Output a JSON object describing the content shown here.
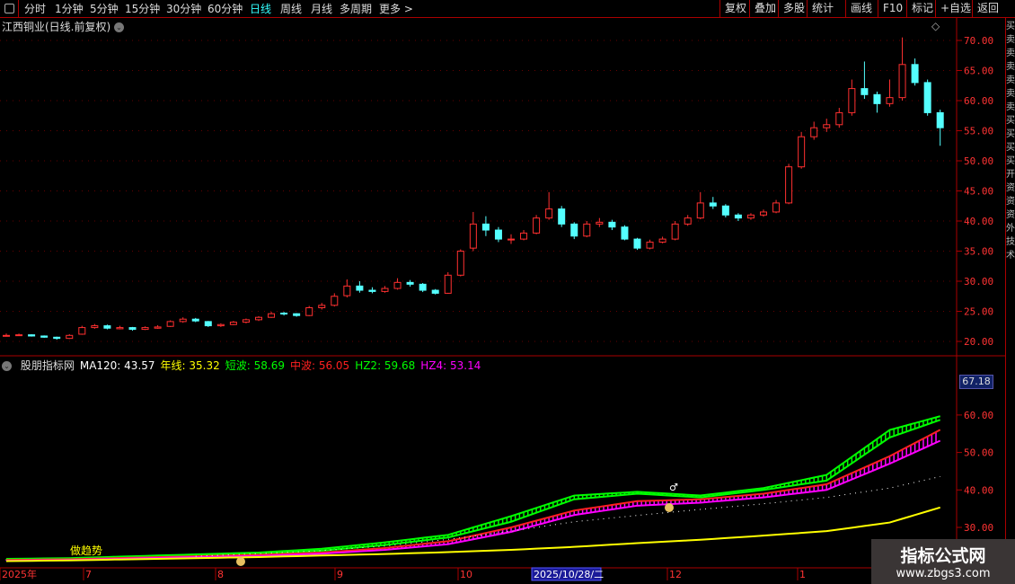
{
  "toolbar": {
    "periods": [
      "分时",
      "1分钟",
      "5分钟",
      "15分钟",
      "30分钟",
      "60分钟",
      "日线",
      "周线",
      "月线",
      "多周期",
      "更多 >"
    ],
    "active_period": "日线",
    "buttons": [
      "复权",
      "叠加",
      "多股",
      "统计",
      "画线",
      "F10",
      "标记",
      "+自选",
      "返回"
    ]
  },
  "main_title": "江西铜业(日线.前复权)",
  "indicator": {
    "name": "股朋指标网",
    "items": [
      {
        "label": "MA120:",
        "value": "43.57",
        "color": "#ffffff"
      },
      {
        "label": "年线:",
        "value": "35.32",
        "color": "#ffff00"
      },
      {
        "label": "短波:",
        "value": "58.69",
        "color": "#00ff00"
      },
      {
        "label": "中波:",
        "value": "56.05",
        "color": "#ff2020"
      },
      {
        "label": "HZ2:",
        "value": "59.68",
        "color": "#00ff00"
      },
      {
        "label": "HZ4:",
        "value": "53.14",
        "color": "#ff00ff"
      }
    ],
    "current_tag": "67.18",
    "signal_label": "做趋势"
  },
  "colors": {
    "up": "#ff3030",
    "down": "#54ffff",
    "axis": "#aa0000",
    "grid": "#660000"
  },
  "chart_data": [
    {
      "type": "candlestick",
      "ylim": [
        17,
        72
      ],
      "yticks": [
        "70.00",
        "65.00",
        "60.00",
        "55.00",
        "50.00",
        "45.00",
        "40.00",
        "35.00",
        "30.00",
        "25.00",
        "20.00"
      ],
      "ohlc": [
        [
          21,
          21.3,
          20.8,
          21
        ],
        [
          21,
          21.3,
          20.9,
          21.1
        ],
        [
          21.1,
          21.2,
          20.8,
          20.9
        ],
        [
          20.9,
          21,
          20.6,
          20.7
        ],
        [
          20.7,
          20.8,
          20.3,
          20.5
        ],
        [
          20.5,
          21.2,
          20.4,
          21
        ],
        [
          21.2,
          22.6,
          21.1,
          22.3
        ],
        [
          22.3,
          22.9,
          22.1,
          22.6
        ],
        [
          22.6,
          22.8,
          22,
          22.2
        ],
        [
          22.1,
          22.6,
          22,
          22.3
        ],
        [
          22.3,
          22.4,
          21.8,
          22
        ],
        [
          22,
          22.5,
          21.9,
          22.3
        ],
        [
          22.2,
          22.7,
          22.1,
          22.4
        ],
        [
          22.5,
          23.5,
          22.4,
          23.3
        ],
        [
          23.3,
          24,
          23.1,
          23.7
        ],
        [
          23.7,
          23.9,
          23.2,
          23.4
        ],
        [
          23.3,
          23.4,
          22.4,
          22.6
        ],
        [
          22.6,
          23,
          22.4,
          22.8
        ],
        [
          22.8,
          23.4,
          22.7,
          23.2
        ],
        [
          23.2,
          23.8,
          23,
          23.6
        ],
        [
          23.6,
          24.2,
          23.4,
          24
        ],
        [
          24,
          24.9,
          23.9,
          24.6
        ],
        [
          24.7,
          24.9,
          24.3,
          24.6
        ],
        [
          24.6,
          24.7,
          24.1,
          24.3
        ],
        [
          24.3,
          25.9,
          24.2,
          25.6
        ],
        [
          25.6,
          26.4,
          25.3,
          26
        ],
        [
          26,
          28,
          25.8,
          27.5
        ],
        [
          27.6,
          30.3,
          27.3,
          29.2
        ],
        [
          29.2,
          30,
          28.1,
          28.5
        ],
        [
          28.5,
          29,
          28,
          28.3
        ],
        [
          28.3,
          29.2,
          28.1,
          28.8
        ],
        [
          28.8,
          30.5,
          28.6,
          29.8
        ],
        [
          29.8,
          30.2,
          29.1,
          29.5
        ],
        [
          29.5,
          29.7,
          28.2,
          28.5
        ],
        [
          28.5,
          28.7,
          27.8,
          28
        ],
        [
          28,
          31.5,
          27.9,
          31
        ],
        [
          31,
          35.3,
          30.8,
          35
        ],
        [
          35.5,
          41.5,
          35,
          39.5
        ],
        [
          39.5,
          40.8,
          37.5,
          38.5
        ],
        [
          38.5,
          39,
          36.5,
          37
        ],
        [
          37,
          37.8,
          36.2,
          37
        ],
        [
          37,
          38.5,
          36.8,
          38
        ],
        [
          38,
          41,
          37.8,
          40.5
        ],
        [
          40.5,
          44.8,
          40.2,
          42
        ],
        [
          42,
          42.5,
          39,
          39.5
        ],
        [
          39.5,
          39.8,
          37,
          37.5
        ],
        [
          37.5,
          40,
          37.3,
          39.5
        ],
        [
          39.5,
          40.5,
          39,
          39.8
        ],
        [
          39.8,
          40.2,
          38.5,
          39
        ],
        [
          39,
          39.3,
          36.8,
          37
        ],
        [
          37,
          37.2,
          35.2,
          35.5
        ],
        [
          35.5,
          36.9,
          35.3,
          36.5
        ],
        [
          36.5,
          37.4,
          36.3,
          37
        ],
        [
          37,
          40,
          36.8,
          39.5
        ],
        [
          39.5,
          41,
          39.2,
          40.5
        ],
        [
          40.5,
          44.8,
          40.3,
          43
        ],
        [
          43,
          44,
          42,
          42.5
        ],
        [
          42.5,
          42.8,
          40.6,
          41
        ],
        [
          41,
          41.3,
          40,
          40.5
        ],
        [
          40.5,
          41.3,
          40.2,
          41
        ],
        [
          41,
          41.9,
          40.7,
          41.5
        ],
        [
          41.5,
          43.5,
          41.3,
          43
        ],
        [
          43,
          49.5,
          42.8,
          49
        ],
        [
          49,
          54.8,
          48.7,
          54
        ],
        [
          54,
          56.5,
          53.5,
          55.5
        ],
        [
          55.5,
          57,
          54.8,
          56
        ],
        [
          56,
          58.8,
          55.5,
          58
        ],
        [
          58,
          63.5,
          57.5,
          62
        ],
        [
          62,
          66.5,
          60.3,
          61
        ],
        [
          61,
          61.5,
          58,
          59.5
        ],
        [
          59.5,
          63.5,
          59,
          60.5
        ],
        [
          60.5,
          70.5,
          60,
          66
        ],
        [
          66,
          67,
          62.5,
          63
        ],
        [
          63,
          63.5,
          57.5,
          58
        ],
        [
          58,
          58.5,
          52.5,
          55.5
        ]
      ]
    },
    {
      "type": "line",
      "ylim": [
        24,
        70
      ],
      "yticks": [
        "60.00",
        "50.00",
        "40.00",
        "30.00"
      ],
      "x_labels": [
        "2025年",
        "7",
        "8",
        "9",
        "10",
        "2025/10/28/二",
        "12",
        "1"
      ],
      "sample_index": [
        0,
        5,
        10,
        15,
        20,
        25,
        30,
        35,
        40,
        45,
        50,
        55,
        60,
        65,
        70,
        74
      ],
      "series": [
        {
          "name": "HZ2",
          "color": "#00ff00",
          "values": [
            21.6,
            21.8,
            22.3,
            22.8,
            23.3,
            24.3,
            26,
            28,
            33,
            38.5,
            39.5,
            38.5,
            40.5,
            44,
            56,
            59.68
          ]
        },
        {
          "name": "短波",
          "color": "#00ff00",
          "values": [
            21.4,
            21.6,
            22.1,
            22.6,
            23,
            23.8,
            25.3,
            27.3,
            31.5,
            37.5,
            39,
            38,
            40,
            42.5,
            54,
            58.69
          ]
        },
        {
          "name": "中波",
          "color": "#ff2020",
          "values": [
            21.3,
            21.5,
            21.9,
            22.3,
            22.7,
            23.3,
            24.5,
            26.3,
            30,
            34.5,
            37,
            37.5,
            39,
            41.5,
            49,
            56.05
          ]
        },
        {
          "name": "HZ4",
          "color": "#ff00ff",
          "values": [
            21.1,
            21.3,
            21.7,
            22.1,
            22.4,
            23,
            24,
            25.5,
            28.8,
            33.3,
            35.8,
            36.6,
            38,
            40,
            47,
            53.14
          ]
        },
        {
          "name": "MA120",
          "color": "#ffffff",
          "values": [
            null,
            null,
            null,
            22.3,
            23,
            23.8,
            25,
            26.8,
            29,
            31.5,
            33.2,
            34.8,
            36.3,
            38,
            40.5,
            43.57
          ]
        },
        {
          "name": "年线",
          "color": "#ffff00",
          "values": [
            21,
            21.2,
            21.5,
            21.8,
            22.1,
            22.5,
            22.9,
            23.4,
            24,
            24.8,
            25.8,
            26.7,
            27.8,
            29,
            31.3,
            35.32
          ]
        }
      ]
    }
  ],
  "watermark": {
    "line1": "指标公式网",
    "line2": "www.zbgs3.com"
  },
  "side_strip": "买卖卖卖卖卖卖买买买买开资资资外技术"
}
